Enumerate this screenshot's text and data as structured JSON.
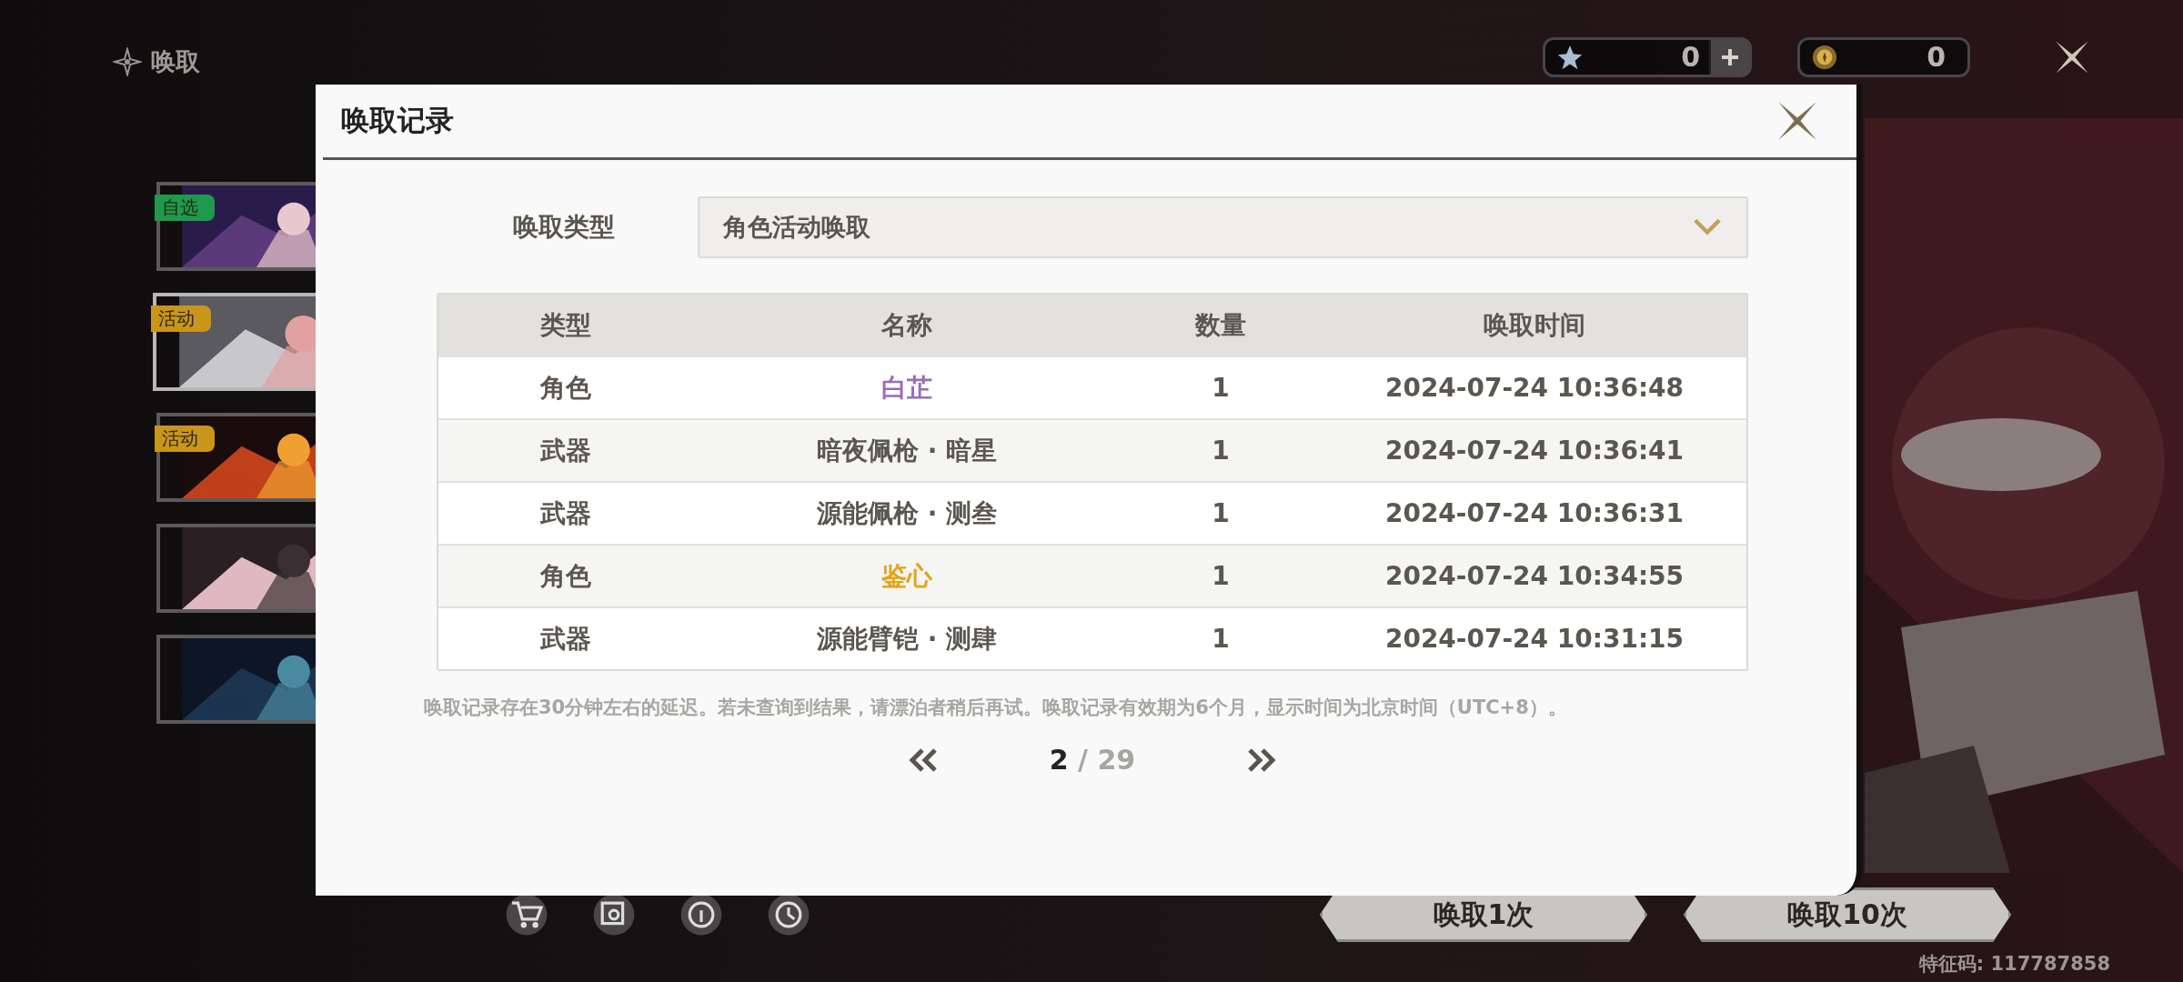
{
  "header": {
    "title": "唤取"
  },
  "currencies": [
    {
      "kind": "star",
      "value": "0",
      "addable": true
    },
    {
      "kind": "coin",
      "value": "0",
      "addable": false
    }
  ],
  "banners": [
    {
      "kind": "picture",
      "tag": "自选",
      "color": "#1f9a4c",
      "selected": false
    },
    {
      "kind": "picture",
      "tag": "活动",
      "color": "#c9961a",
      "selected": true
    },
    {
      "kind": "picture",
      "tag": "活动",
      "color": "#c9961a",
      "selected": false
    },
    {
      "kind": "picture",
      "selected": false
    },
    {
      "kind": "picture",
      "selected": false
    }
  ],
  "draw_buttons": [
    {
      "label": "唤取1次"
    },
    {
      "label": "唤取10次"
    }
  ],
  "footer": {
    "code": "特征码: 117787858"
  },
  "dialog": {
    "title": "唤取记录",
    "filter": {
      "label": "唤取类型",
      "value": "角色活动唤取"
    },
    "table": {
      "columns": [
        "类型",
        "名称",
        "数量",
        "唤取时间"
      ],
      "rows": [
        {
          "cells": [
            "角色",
            "白芷",
            "1",
            "2024-07-24 10:36:48"
          ],
          "color": "#9a6db4"
        },
        {
          "cells": [
            "武器",
            "暗夜佩枪 · 暗星",
            "1",
            "2024-07-24 10:36:41"
          ],
          "color": "#5b5650"
        },
        {
          "cells": [
            "武器",
            "源能佩枪 · 测叁",
            "1",
            "2024-07-24 10:36:31"
          ],
          "color": "#5b5650"
        },
        {
          "cells": [
            "角色",
            "鉴心",
            "1",
            "2024-07-24 10:34:55"
          ],
          "color": "#e2a51c"
        },
        {
          "cells": [
            "武器",
            "源能臂铠 · 测肆",
            "1",
            "2024-07-24 10:31:15"
          ],
          "color": "#5b5650"
        }
      ]
    },
    "note": "唤取记录存在30分钟左右的延迟。若未查询到结果，请漂泊者稍后再试。唤取记录有效期为6个月，显示时间为北京时间（UTC+8）。",
    "pagination": {
      "current": "2",
      "total": "/ 29"
    }
  }
}
